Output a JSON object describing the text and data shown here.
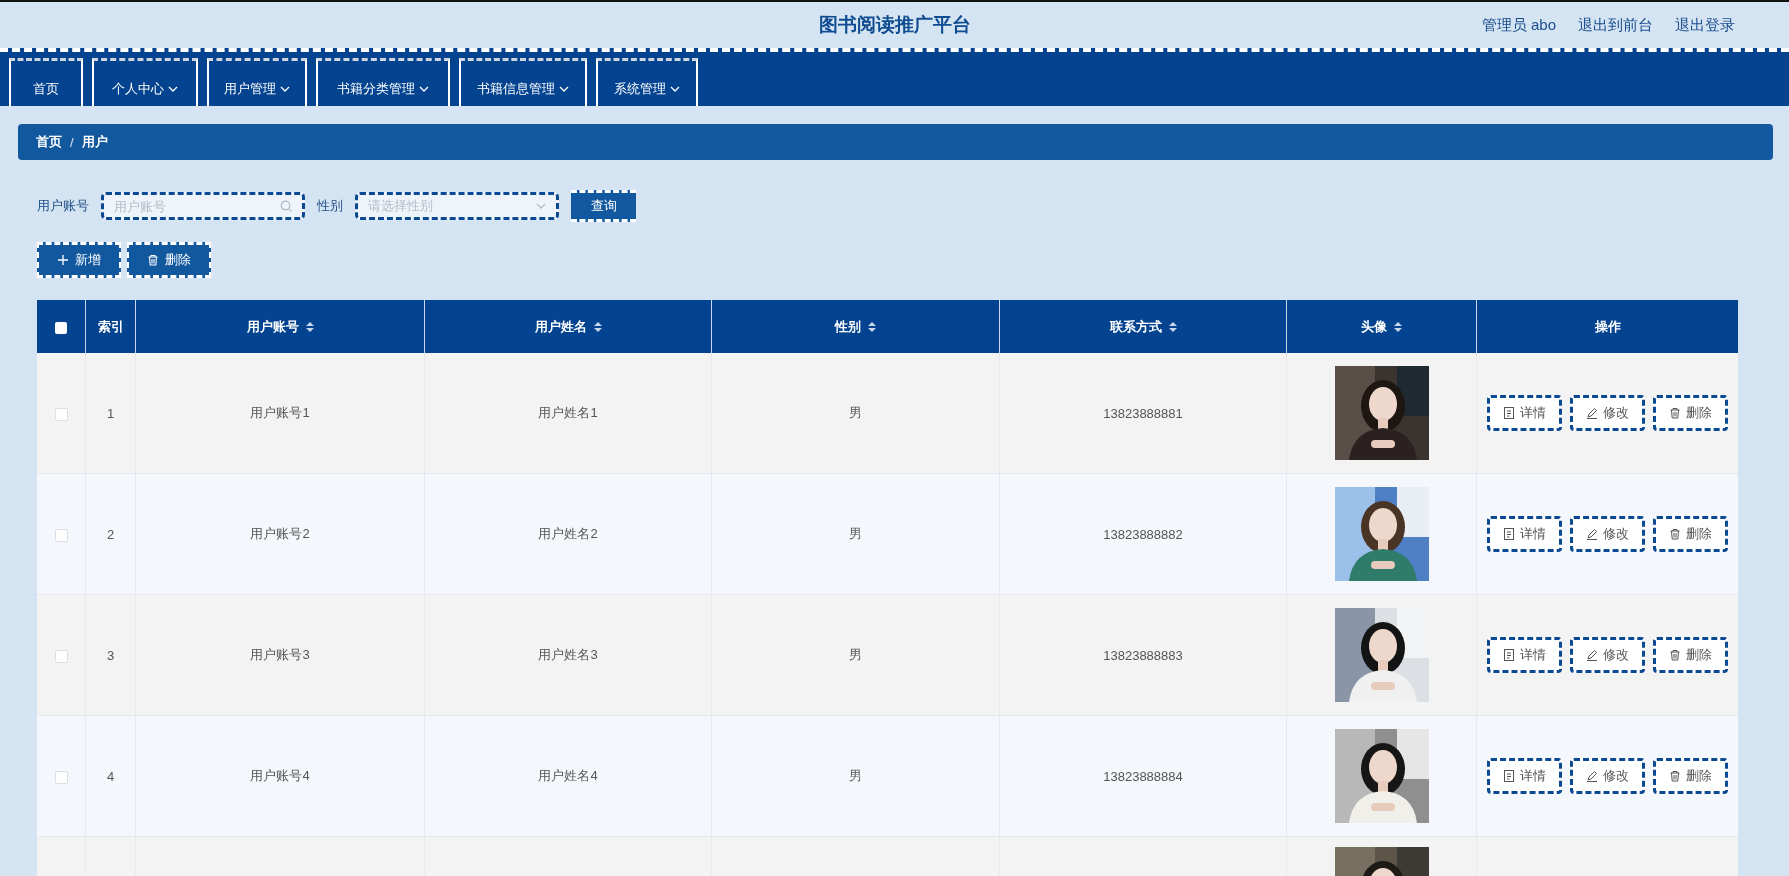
{
  "header": {
    "title": "图书阅读推广平台",
    "links": [
      "管理员 abo",
      "退出到前台",
      "退出登录"
    ]
  },
  "nav": [
    {
      "label": "首页",
      "dropdown": false
    },
    {
      "label": "个人中心",
      "dropdown": true
    },
    {
      "label": "用户管理",
      "dropdown": true
    },
    {
      "label": "书籍分类管理",
      "dropdown": true
    },
    {
      "label": "书籍信息管理",
      "dropdown": true
    },
    {
      "label": "系统管理",
      "dropdown": true
    }
  ],
  "breadcrumb": [
    "首页",
    "/",
    "用户"
  ],
  "search": {
    "account_label": "用户账号",
    "account_placeholder": "用户账号",
    "gender_label": "性别",
    "gender_placeholder": "请选择性别",
    "query_button": "查询"
  },
  "actions": [
    "新增",
    "删除"
  ],
  "table": {
    "select_all": {
      "checked": false
    },
    "columns": [
      {
        "label": "索引",
        "sortable": false
      },
      {
        "label": "用户账号",
        "sortable": true
      },
      {
        "label": "用户姓名",
        "sortable": true
      },
      {
        "label": "性别",
        "sortable": true
      },
      {
        "label": "联系方式",
        "sortable": true
      },
      {
        "label": "头像",
        "sortable": true
      },
      {
        "label": "操作",
        "sortable": false
      }
    ],
    "rows": [
      {
        "checked": false,
        "index": "1",
        "account": "用户账号1",
        "name": "用户姓名1",
        "gender": "男",
        "phone": "13823888881",
        "avatar": {
          "kind": "picture"
        },
        "buttons": [
          "详情",
          "修改",
          "删除"
        ]
      },
      {
        "checked": false,
        "index": "2",
        "account": "用户账号2",
        "name": "用户姓名2",
        "gender": "男",
        "phone": "13823888882",
        "avatar": {
          "kind": "picture"
        },
        "buttons": [
          "详情",
          "修改",
          "删除"
        ]
      },
      {
        "checked": false,
        "index": "3",
        "account": "用户账号3",
        "name": "用户姓名3",
        "gender": "男",
        "phone": "13823888883",
        "avatar": {
          "kind": "picture"
        },
        "buttons": [
          "详情",
          "修改",
          "删除"
        ]
      },
      {
        "checked": false,
        "index": "4",
        "account": "用户账号4",
        "name": "用户姓名4",
        "gender": "男",
        "phone": "13823888884",
        "avatar": {
          "kind": "picture"
        },
        "buttons": [
          "详情",
          "修改",
          "删除"
        ]
      },
      {
        "avatar": {
          "kind": "picture"
        }
      }
    ]
  }
}
